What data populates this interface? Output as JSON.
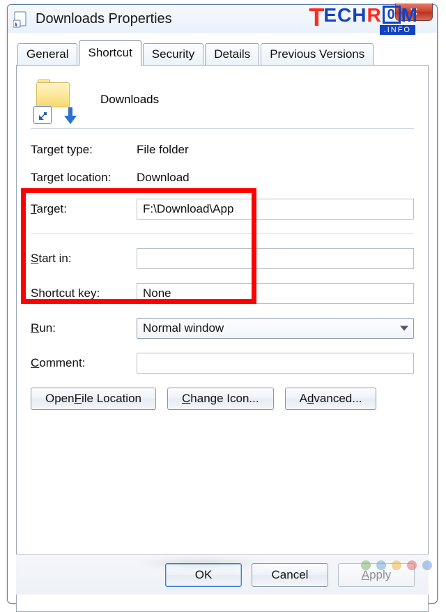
{
  "window": {
    "title": "Downloads Properties",
    "close_label": "✕"
  },
  "tabs": {
    "general": "General",
    "shortcut": "Shortcut",
    "security": "Security",
    "details": "Details",
    "previous": "Previous Versions"
  },
  "header": {
    "name": "Downloads"
  },
  "target_type": {
    "label": "Target type:",
    "value": "File folder"
  },
  "target_location": {
    "label": "Target location:",
    "value": "Download"
  },
  "target": {
    "label_pre": "T",
    "label_rest": "arget:",
    "value": "F:\\Download\\App"
  },
  "start_in": {
    "label_pre": "S",
    "label_rest": "tart in:",
    "value": ""
  },
  "shortcut_key": {
    "label": "Shortcut key:",
    "value": "None"
  },
  "run": {
    "label_pre": "R",
    "label_rest": "un:",
    "value": "Normal window"
  },
  "comment": {
    "label_pre": "C",
    "label_rest": "omment:",
    "value": ""
  },
  "buttons": {
    "open_loc_pre": "Open ",
    "open_loc_u": "F",
    "open_loc_rest": "ile Location",
    "change_icon_pre": "",
    "change_icon_u": "C",
    "change_icon_rest": "hange Icon...",
    "advanced_pre": "A",
    "advanced_u": "d",
    "advanced_rest": "vanced..."
  },
  "footer": {
    "ok": "OK",
    "cancel": "Cancel",
    "apply_pre": "",
    "apply_u": "A",
    "apply_rest": "pply"
  },
  "logo": {
    "t": "T",
    "ech": "ECH",
    "r": "R",
    "o": "0",
    "m": "M",
    "info": ".INFO"
  }
}
